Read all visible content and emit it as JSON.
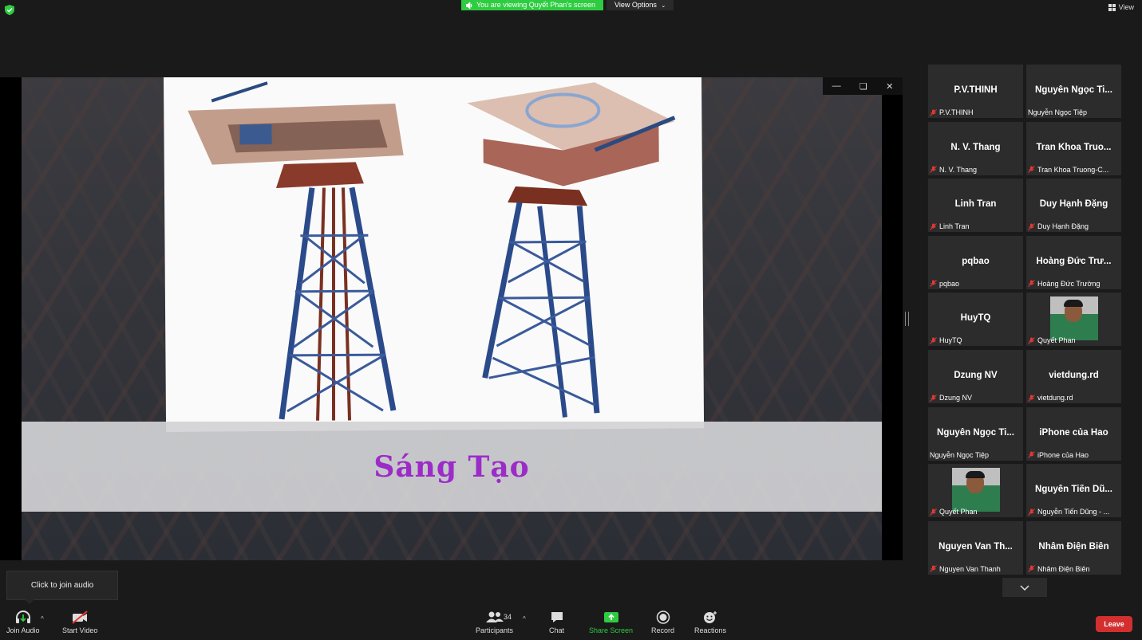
{
  "banner": {
    "viewing_text": "You are viewing Quyết Phan's screen",
    "view_options_label": "View Options",
    "view_label": "View"
  },
  "slide": {
    "caption": "Sáng Tạo"
  },
  "participants": [
    {
      "name": "P.V.THINH",
      "label": "P.V.THINH",
      "muted": true,
      "video": false
    },
    {
      "name": "Nguyễn Ngọc Ti...",
      "label": "Nguyễn Ngọc Tiệp",
      "muted": false,
      "video": false
    },
    {
      "name": "N. V. Thang",
      "label": "N. V. Thang",
      "muted": true,
      "video": false
    },
    {
      "name": "Tran Khoa Truo...",
      "label": "Tran Khoa Truong-C...",
      "muted": true,
      "video": false
    },
    {
      "name": "Linh Tran",
      "label": "Linh Tran",
      "muted": true,
      "video": false
    },
    {
      "name": "Duy Hạnh Đặng",
      "label": "Duy Hạnh Đặng",
      "muted": true,
      "video": false
    },
    {
      "name": "pqbao",
      "label": "pqbao",
      "muted": true,
      "video": false
    },
    {
      "name": "Hoàng Đức Trư...",
      "label": "Hoàng Đức Trường",
      "muted": true,
      "video": false
    },
    {
      "name": "HuyTQ",
      "label": "HuyTQ",
      "muted": true,
      "video": false
    },
    {
      "name": "",
      "label": "Quyết Phan",
      "muted": true,
      "video": true
    },
    {
      "name": "Dzung NV",
      "label": "Dzung NV",
      "muted": true,
      "video": false
    },
    {
      "name": "vietdung.rd",
      "label": "vietdung.rd",
      "muted": true,
      "video": false
    },
    {
      "name": "Nguyễn Ngọc Ti...",
      "label": "Nguyễn Ngọc Tiệp",
      "muted": false,
      "video": false
    },
    {
      "name": "iPhone của Hao",
      "label": "iPhone của Hao",
      "muted": true,
      "video": false
    },
    {
      "name": "",
      "label": "Quyết Phan",
      "muted": true,
      "video": true
    },
    {
      "name": "Nguyễn Tiến Dũ...",
      "label": "Nguyễn Tiến Dũng - ...",
      "muted": true,
      "video": false
    },
    {
      "name": "Nguyen Van Th...",
      "label": "Nguyen Van Thanh",
      "muted": true,
      "video": false
    },
    {
      "name": "Nhâm Điện Biên",
      "label": "Nhâm Điện Biên",
      "muted": true,
      "video": false
    }
  ],
  "tooltip": {
    "text": "Click to join audio"
  },
  "toolbar": {
    "join_audio": "Join Audio",
    "start_video": "Start Video",
    "participants": "Participants",
    "participant_count": "34",
    "chat": "Chat",
    "share_screen": "Share Screen",
    "record": "Record",
    "reactions": "Reactions",
    "leave": "Leave"
  },
  "colors": {
    "share_green": "#2ecc40",
    "leave_red": "#d32f2f",
    "mute_red": "#e53935",
    "caption_purple": "#9b2cc8"
  }
}
